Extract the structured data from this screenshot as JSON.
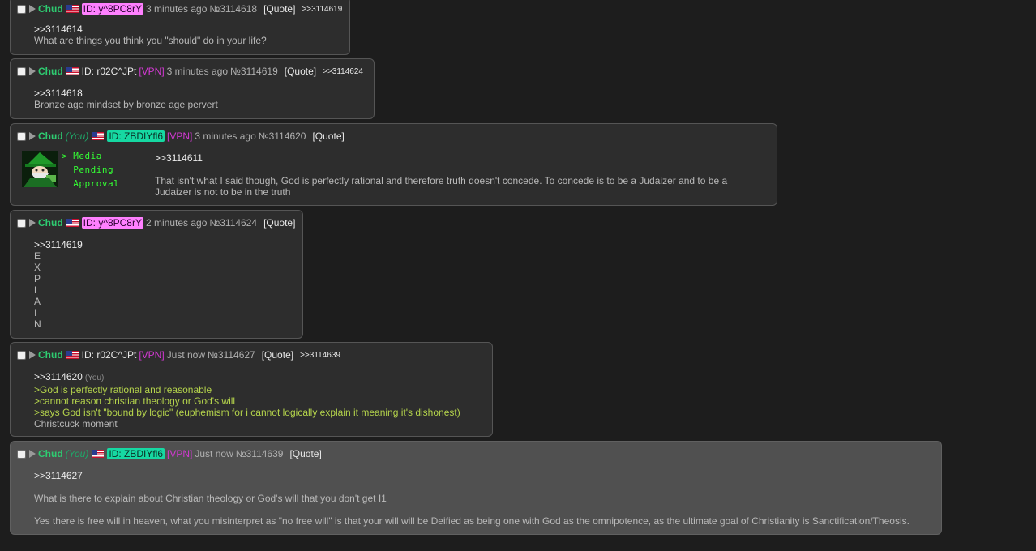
{
  "posts": [
    {
      "name": "Chud",
      "id": "ID: y^8PC8rY",
      "time": "3 minutes ago",
      "number": "№3114618",
      "quote": "[Quote]",
      "replies": ">>3114619",
      "ref": ">>3114614",
      "lines": [
        "What are things you think you \"should\" do in your life?"
      ]
    },
    {
      "name": "Chud",
      "id": "ID: r02C^JPt",
      "vpn": "[VPN]",
      "time": "3 minutes ago",
      "number": "№3114619",
      "quote": "[Quote]",
      "replies": ">>3114624",
      "ref": ">>3114618",
      "lines": [
        "Bronze age mindset by bronze age pervert"
      ]
    },
    {
      "name": "Chud",
      "you": "(You)",
      "id": "ID: ZBDIYfl6",
      "vpn": "[VPN]",
      "time": "3 minutes ago",
      "number": "№3114620",
      "quote": "[Quote]",
      "media": "> Media\n  Pending\n  Approval",
      "ref": ">>3114611",
      "lines": [
        "That isn't what I said though, God is perfectly rational and therefore truth doesn't concede. To concede is to be a Judaizer and to be a",
        "Judaizer is not to be in the truth"
      ]
    },
    {
      "name": "Chud",
      "id": "ID: y^8PC8rY",
      "time": "2 minutes ago",
      "number": "№3114624",
      "quote": "[Quote]",
      "ref": ">>3114619",
      "lines": [
        "E",
        "X",
        "P",
        "L",
        "A",
        "I",
        "N"
      ]
    },
    {
      "name": "Chud",
      "id": "ID: r02C^JPt",
      "vpn": "[VPN]",
      "time": "Just now",
      "number": "№3114627",
      "quote": "[Quote]",
      "replies": ">>3114639",
      "ref": ">>3114620",
      "ref_you": "(You)",
      "greentext": [
        ">God is perfectly rational and reasonable",
        ">cannot reason christian theology or God's will",
        ">says God isn't \"bound by logic\" (euphemism for i cannot logically explain it meaning it's dishonest)"
      ],
      "lines": [
        "Christcuck moment"
      ]
    },
    {
      "name": "Chud",
      "you": "(You)",
      "id": "ID: ZBDIYfl6",
      "vpn": "[VPN]",
      "time": "Just now",
      "number": "№3114639",
      "quote": "[Quote]",
      "ref": ">>3114627",
      "lines": [
        "What is there to explain about Christian theology or God's will that you don't get I1",
        "Yes there is free will in heaven, what you misinterpret as \"no free will\" is that your will will be Deified as being one with God as the omnipotence, as the ultimate goal of Christianity is Sanctification/Theosis."
      ]
    }
  ],
  "colors": {
    "background": "#1d1d1d",
    "post_bg": "#2d2d2d",
    "highlight_bg": "#505050",
    "name": "#2ecc71",
    "vpn": "#d239d2",
    "greentext": "#b5d44c",
    "id_pink": "#ff80ff",
    "id_teal": "#16d8a2"
  }
}
